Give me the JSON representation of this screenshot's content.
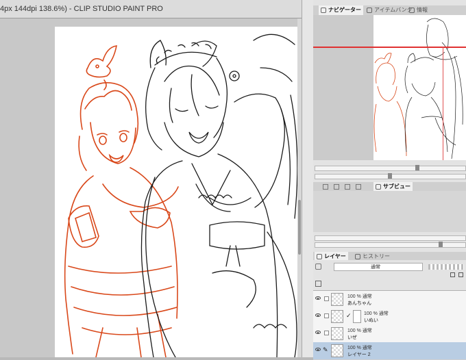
{
  "window": {
    "title": "4px 144dpi 138.6%)  - CLIP STUDIO PAINT PRO"
  },
  "navigator_panel": {
    "tabs": [
      {
        "label": "ナビゲーター",
        "icon": "navigator-icon",
        "active": true
      },
      {
        "label": "アイテムバンク",
        "icon": "item-bank-icon",
        "active": false
      },
      {
        "label": "情報",
        "icon": "info-icon",
        "active": false
      }
    ],
    "frame_color": "#e03030"
  },
  "sub_panel": {
    "tabs": [
      {
        "label": "サブビュー",
        "icon": "subview-icon",
        "active": true
      }
    ]
  },
  "layer_panel": {
    "tabs": [
      {
        "label": "レイヤー",
        "icon": "layer-icon",
        "active": true
      },
      {
        "label": "ヒストリー",
        "icon": "history-icon",
        "active": false
      }
    ],
    "blend_mode": "通常",
    "layers": [
      {
        "percent": "100 %",
        "mode": "通常",
        "name": "あんちゃん",
        "visible": true,
        "selected": false
      },
      {
        "percent": "100 %",
        "mode": "通常",
        "name": "いぬい",
        "visible": true,
        "selected": false
      },
      {
        "percent": "100 %",
        "mode": "通常",
        "name": "いぜ",
        "visible": true,
        "selected": false
      },
      {
        "percent": "100 %",
        "mode": "通常",
        "name": "レイヤー 2",
        "visible": true,
        "selected": true
      }
    ]
  },
  "colors": {
    "sketch_orange": "#d9481a",
    "line_black": "#1a1a1a",
    "selected_layer": "#b9cde3"
  }
}
